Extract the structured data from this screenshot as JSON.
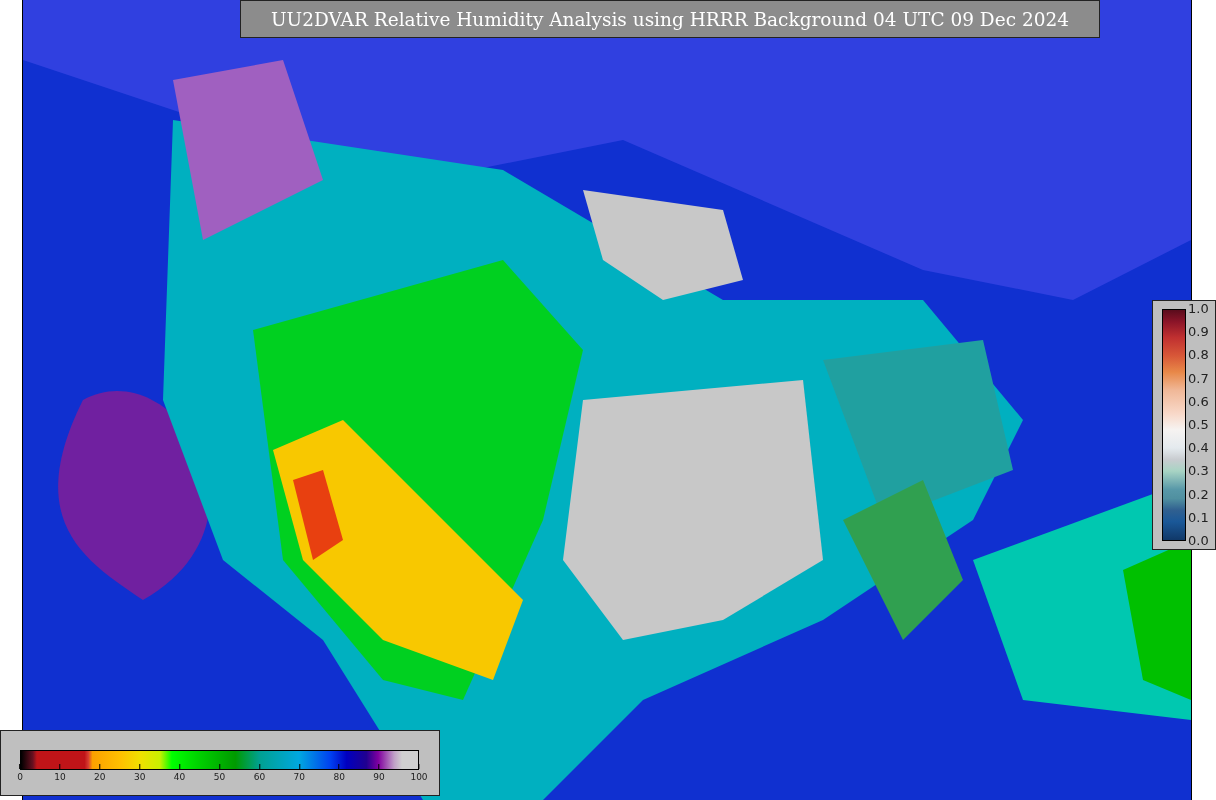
{
  "title": "UU2DVAR Relative Humidity Analysis using HRRR Background 04 UTC 09 Dec 2024",
  "humidity_colorbar": {
    "ticks": [
      "0",
      "10",
      "20",
      "30",
      "40",
      "50",
      "60",
      "70",
      "80",
      "90",
      "100"
    ]
  },
  "ratio_colorbar": {
    "ticks": [
      "1.0",
      "0.9",
      "0.8",
      "0.7",
      "0.6",
      "0.5",
      "0.4",
      "0.3",
      "0.2",
      "0.1",
      "0.0"
    ]
  }
}
